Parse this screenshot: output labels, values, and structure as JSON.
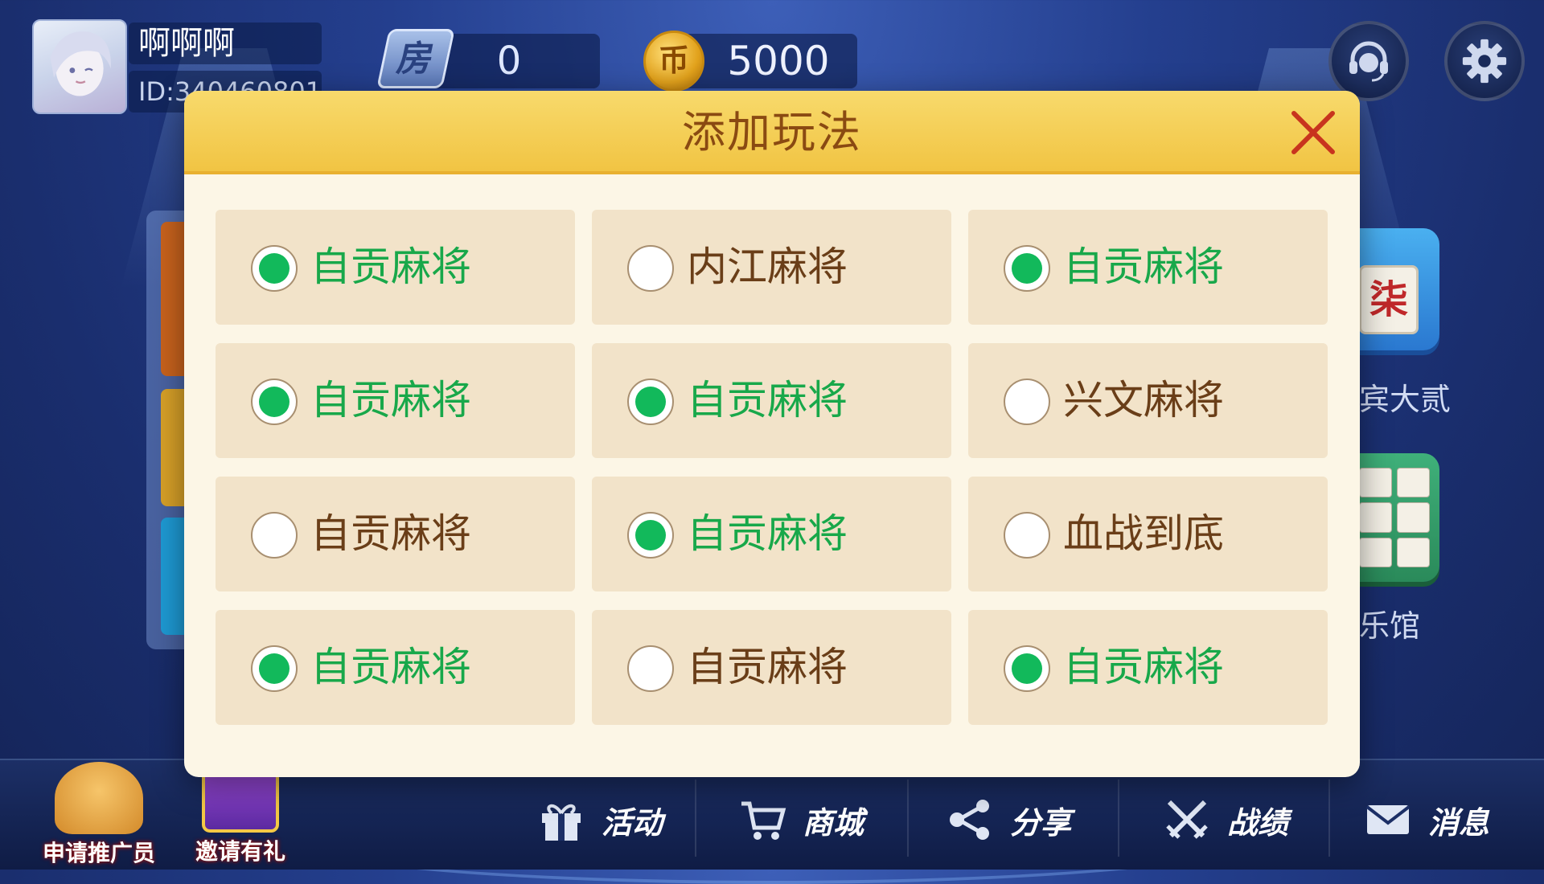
{
  "user": {
    "name": "啊啊啊",
    "id": "ID:340460801"
  },
  "currency": {
    "room_icon_label": "房",
    "room_cards": "0",
    "coin_icon_label": "币",
    "coins": "5000"
  },
  "header_buttons": {
    "service_icon": "headset-icon",
    "settings_icon": "gear-icon"
  },
  "background": {
    "tile_char": "柒",
    "game_label_1": "宾大贰",
    "game_label_2": "乐馆"
  },
  "modal": {
    "title": "添加玩法",
    "options": [
      {
        "label": "自贡麻将",
        "selected": true
      },
      {
        "label": "内江麻将",
        "selected": false
      },
      {
        "label": "自贡麻将",
        "selected": true
      },
      {
        "label": "自贡麻将",
        "selected": true
      },
      {
        "label": "自贡麻将",
        "selected": true
      },
      {
        "label": "兴文麻将",
        "selected": false
      },
      {
        "label": "自贡麻将",
        "selected": false
      },
      {
        "label": "自贡麻将",
        "selected": true
      },
      {
        "label": "血战到底",
        "selected": false
      },
      {
        "label": "自贡麻将",
        "selected": true
      },
      {
        "label": "自贡麻将",
        "selected": false
      },
      {
        "label": "自贡麻将",
        "selected": true
      }
    ]
  },
  "bottom": {
    "promo_1": "申请推广员",
    "promo_2": "邀请有礼",
    "nav": [
      {
        "label": "活动",
        "icon": "gift-icon"
      },
      {
        "label": "商城",
        "icon": "cart-icon"
      },
      {
        "label": "分享",
        "icon": "share-icon"
      },
      {
        "label": "战绩",
        "icon": "crossed-swords-icon"
      },
      {
        "label": "消息",
        "icon": "mail-icon"
      }
    ]
  },
  "colors": {
    "selected_green": "#12b95b",
    "header_yellow": "#f1c443",
    "title_brown": "#8a4a12",
    "panel_cream": "#fcf6e6",
    "option_bg": "#f2e3c9"
  }
}
